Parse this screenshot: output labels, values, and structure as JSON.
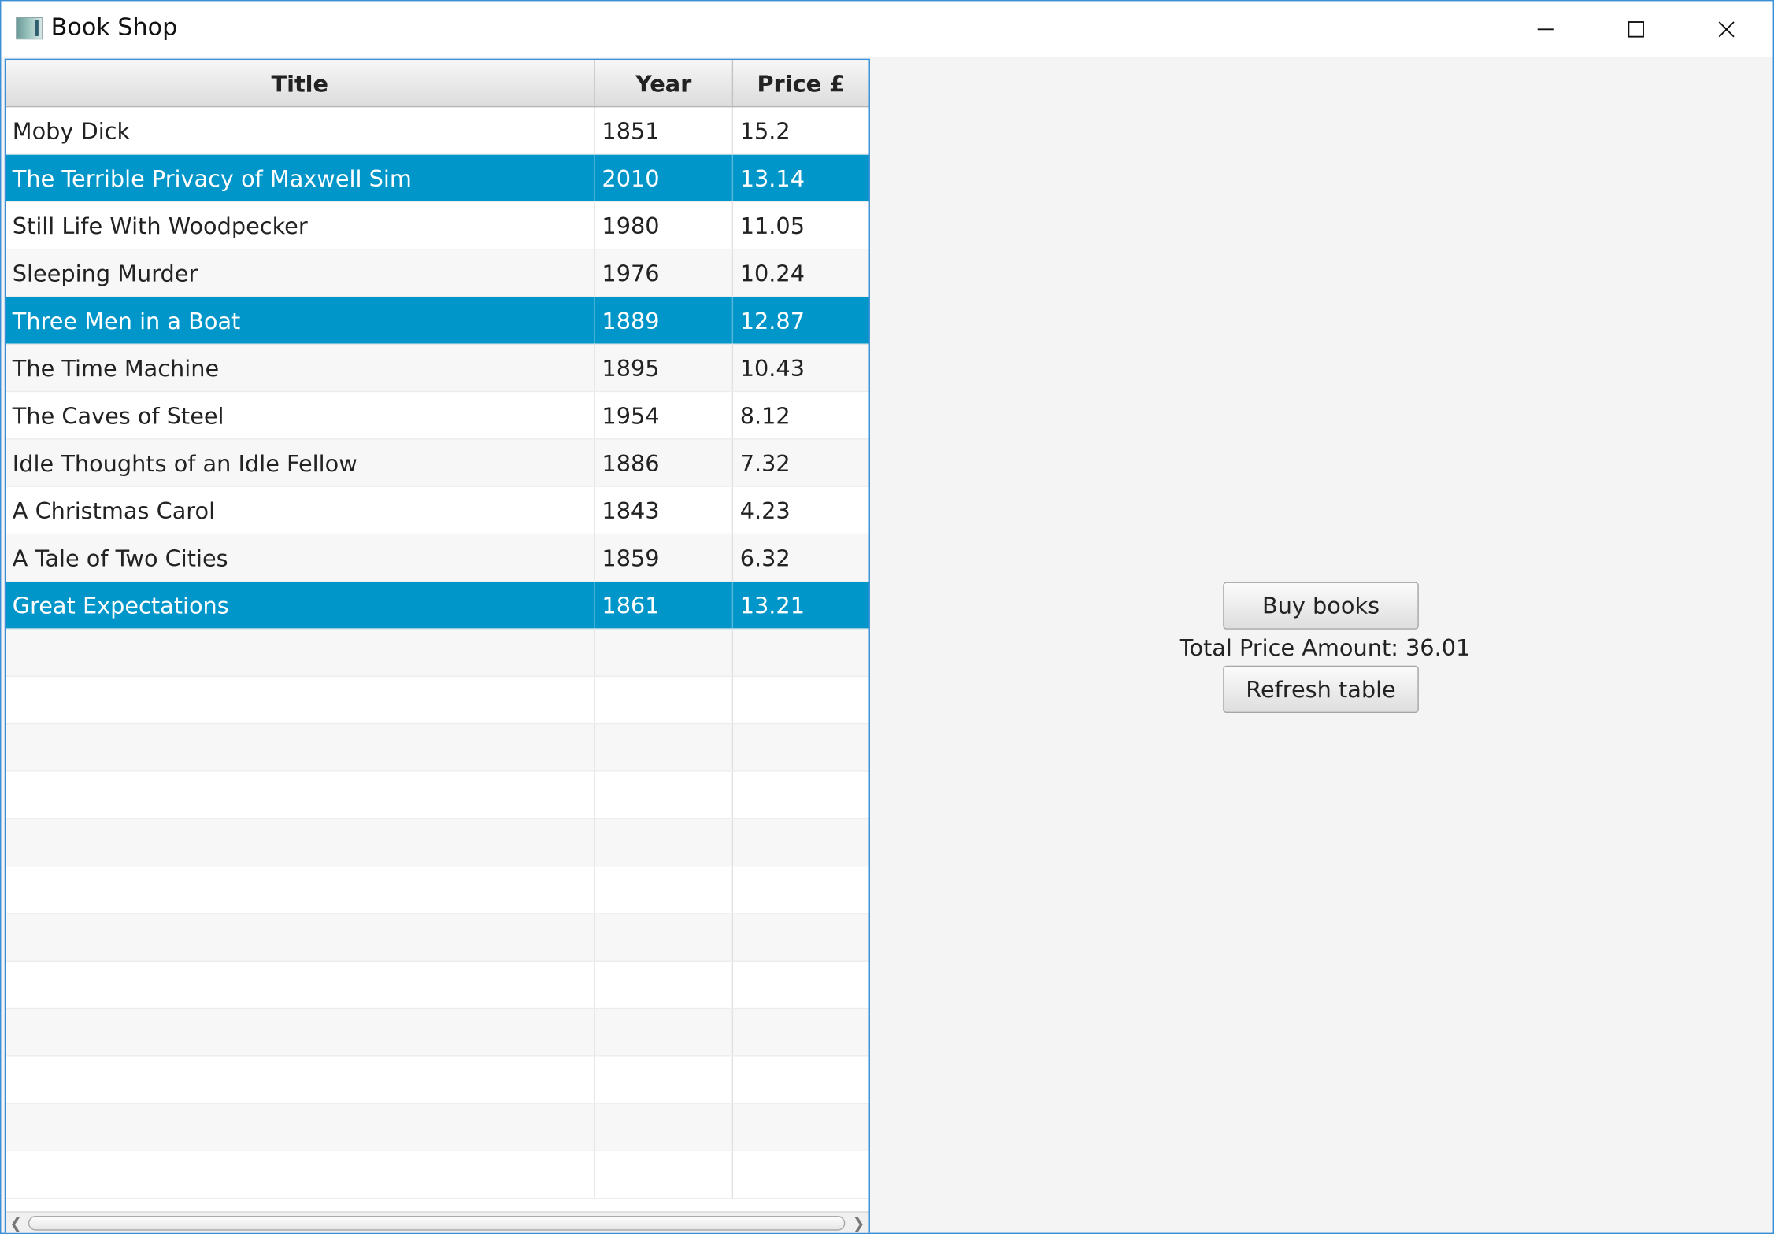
{
  "window": {
    "title": "Book Shop",
    "controls": {
      "minimize": "minimize",
      "maximize": "maximize",
      "close": "close"
    }
  },
  "table": {
    "columns": [
      "Title",
      "Year",
      "Price £"
    ],
    "rows": [
      {
        "title": "Moby Dick",
        "year": "1851",
        "price": "15.2",
        "selected": false
      },
      {
        "title": "The Terrible Privacy of Maxwell Sim",
        "year": "2010",
        "price": "13.14",
        "selected": true
      },
      {
        "title": "Still Life With Woodpecker",
        "year": "1980",
        "price": "11.05",
        "selected": false
      },
      {
        "title": "Sleeping Murder",
        "year": "1976",
        "price": "10.24",
        "selected": false
      },
      {
        "title": "Three Men in a Boat",
        "year": "1889",
        "price": "12.87",
        "selected": true
      },
      {
        "title": "The Time Machine",
        "year": "1895",
        "price": "10.43",
        "selected": false
      },
      {
        "title": "The Caves of Steel",
        "year": "1954",
        "price": "8.12",
        "selected": false
      },
      {
        "title": "Idle Thoughts of an Idle Fellow",
        "year": "1886",
        "price": "7.32",
        "selected": false
      },
      {
        "title": "A Christmas Carol",
        "year": "1843",
        "price": "4.23",
        "selected": false
      },
      {
        "title": "A Tale of Two Cities",
        "year": "1859",
        "price": "6.32",
        "selected": false
      },
      {
        "title": "Great Expectations",
        "year": "1861",
        "price": "13.21",
        "selected": true
      }
    ],
    "empty_rows": 12
  },
  "actions": {
    "buy_label": "Buy books",
    "total_label": "Total Price Amount: 36.01",
    "refresh_label": "Refresh table"
  },
  "colors": {
    "selection": "#0096c9",
    "window_border": "#3a8fd6",
    "panel_background": "#f4f4f4"
  }
}
